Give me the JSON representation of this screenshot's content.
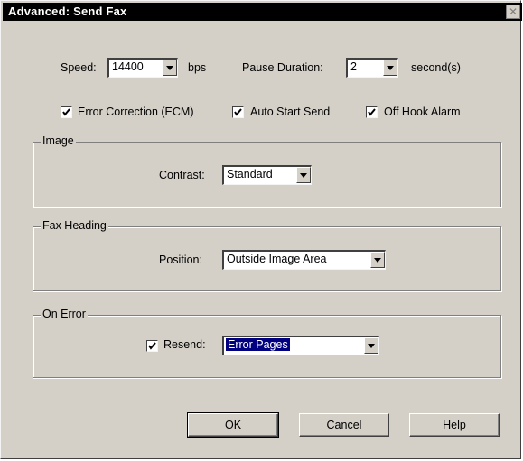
{
  "window": {
    "title": "Advanced: Send Fax",
    "close_glyph": "✕"
  },
  "top": {
    "speed_label": "Speed:",
    "speed_value": "14400",
    "speed_unit": "bps",
    "pause_label": "Pause Duration:",
    "pause_value": "2",
    "pause_unit": "second(s)"
  },
  "checkboxes": {
    "ecm_label": "Error Correction (ECM)",
    "ecm_checked": true,
    "auto_start_label": "Auto Start Send",
    "auto_start_checked": true,
    "off_hook_label": "Off Hook Alarm",
    "off_hook_checked": true
  },
  "image_group": {
    "legend": "Image",
    "contrast_label": "Contrast:",
    "contrast_value": "Standard"
  },
  "heading_group": {
    "legend": "Fax Heading",
    "position_label": "Position:",
    "position_value": "Outside Image Area"
  },
  "error_group": {
    "legend": "On Error",
    "resend_label": "Resend:",
    "resend_checked": true,
    "resend_value": "Error Pages"
  },
  "buttons": {
    "ok": "OK",
    "cancel": "Cancel",
    "help": "Help"
  }
}
